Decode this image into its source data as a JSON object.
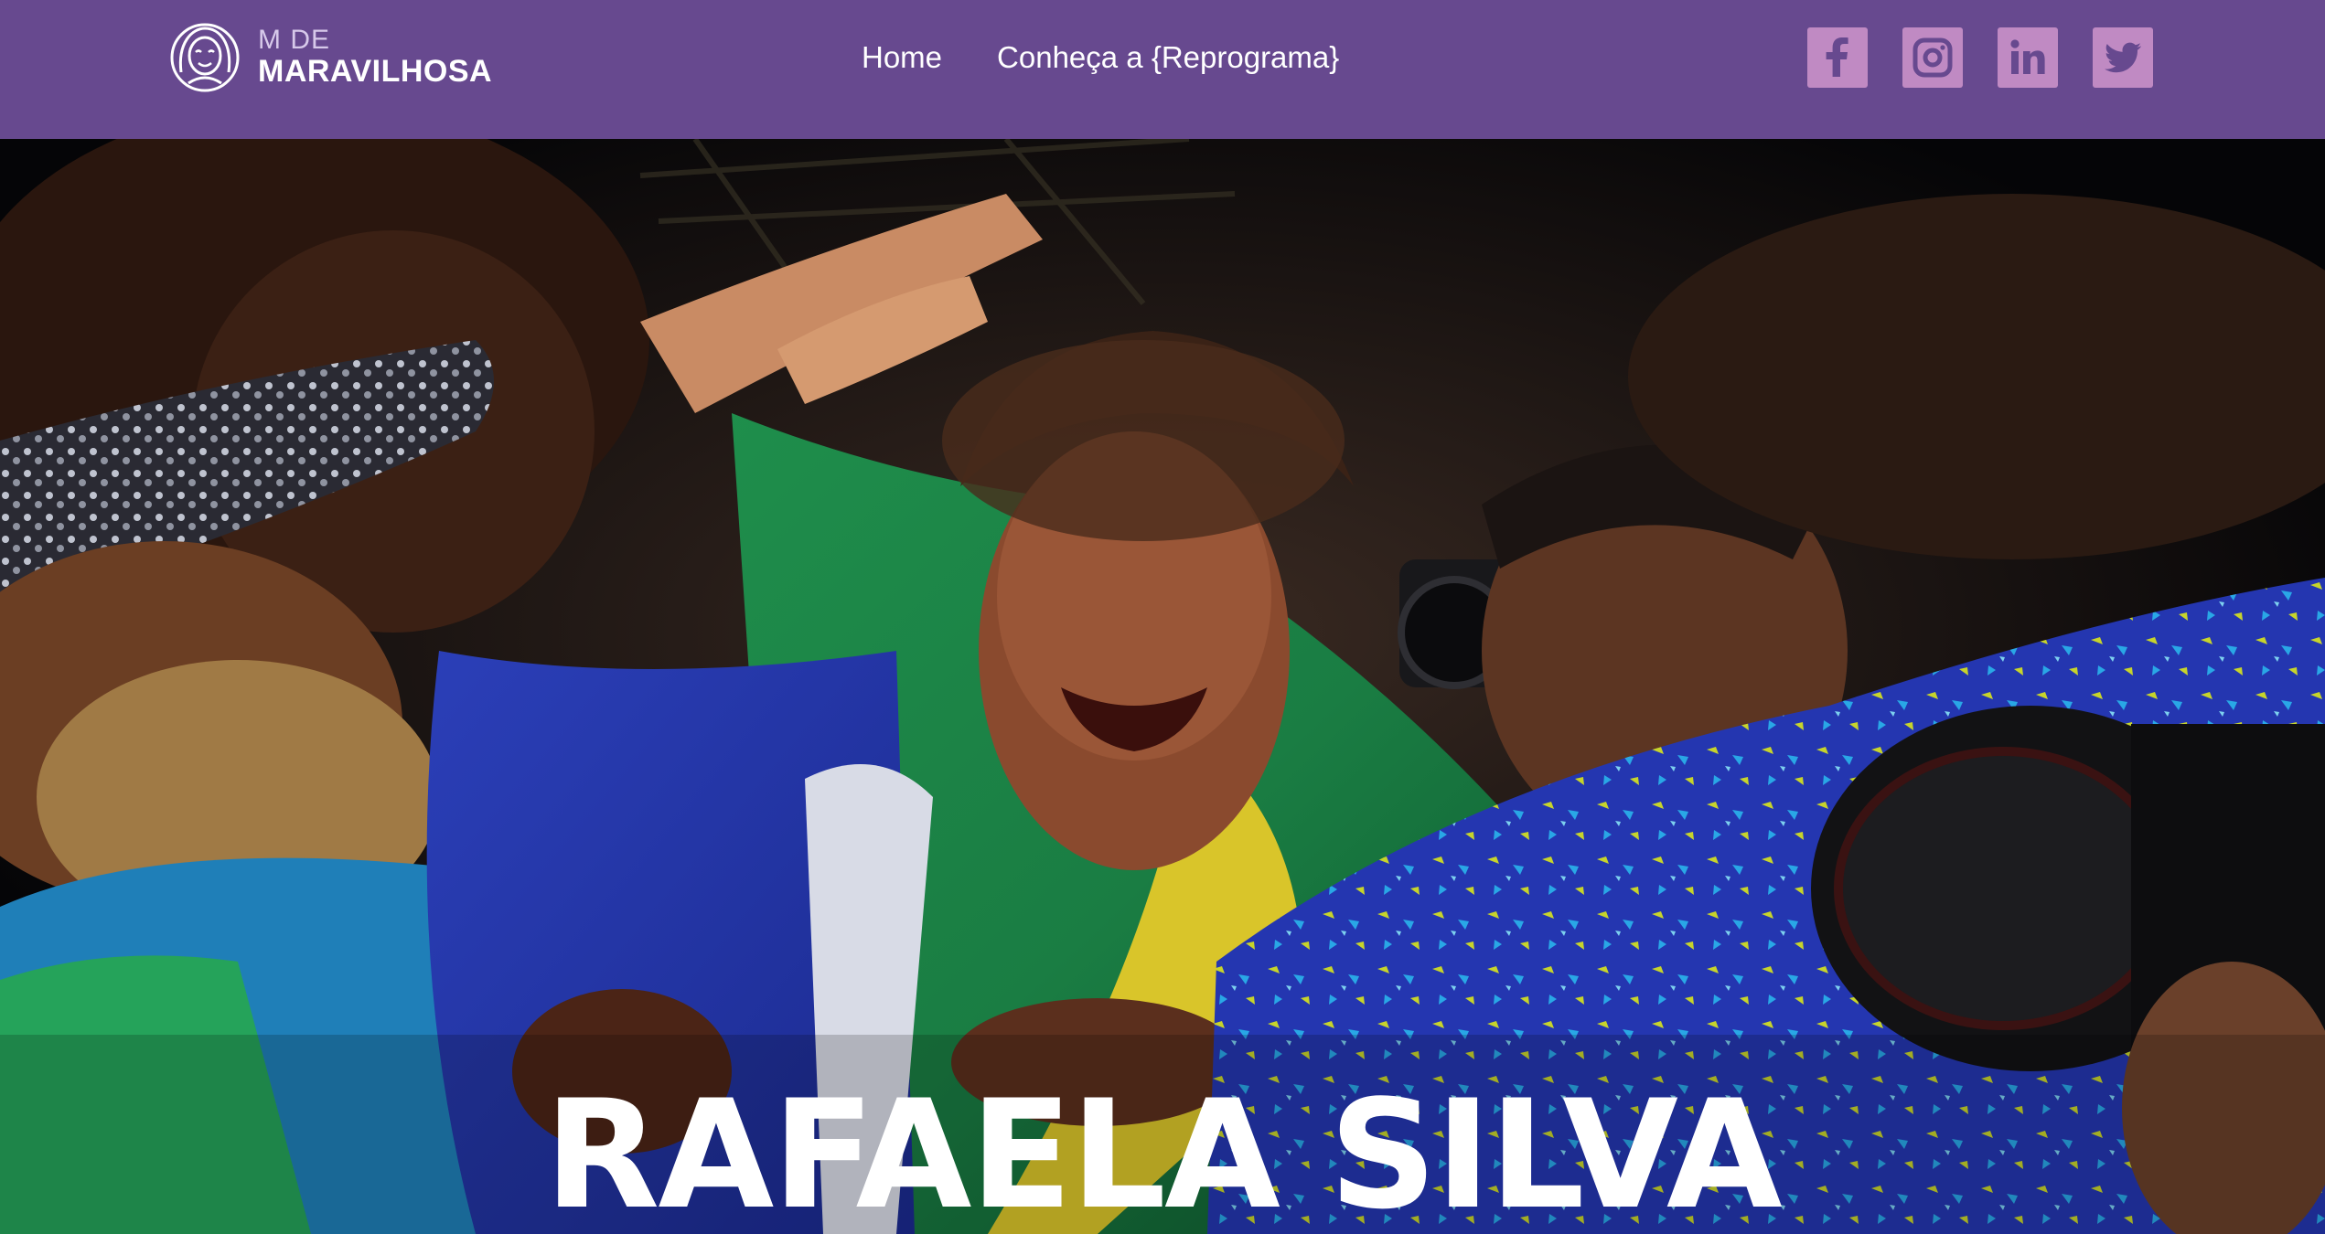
{
  "logo": {
    "line1": "M DE",
    "line2": "MARAVILHOSA",
    "icon": "woman-face-icon"
  },
  "nav": {
    "items": [
      {
        "label": "Home"
      },
      {
        "label": "Conheça a {Reprograma}"
      }
    ]
  },
  "social": [
    {
      "icon": "facebook-icon"
    },
    {
      "icon": "instagram-icon"
    },
    {
      "icon": "linkedin-icon"
    },
    {
      "icon": "twitter-icon"
    }
  ],
  "hero": {
    "title": "RAFAELA SILVA",
    "image": "photo-crowd-celebration"
  },
  "colors": {
    "navbar": "#67498f",
    "social_button": "#c08ac3",
    "text": "#ffffff"
  }
}
